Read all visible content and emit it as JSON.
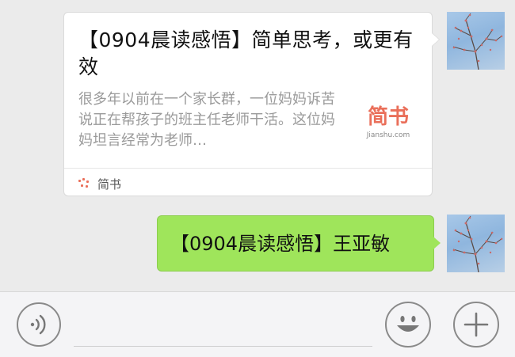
{
  "conversation": {
    "messages": [
      {
        "type": "link_card",
        "title": "【0904晨读感悟】简单思考，或更有效",
        "description": "很多年以前在一个家长群，一位妈妈诉苦说正在帮孩子的班主任老师干活。这位妈妈坦言经常为老师…",
        "thumbnail_text": "简书",
        "thumbnail_subtext": "Jianshu.com",
        "source": "简书"
      },
      {
        "type": "text",
        "text": "【0904晨读感悟】王亚敏",
        "bubble_color": "#9fe55b"
      }
    ]
  },
  "input_bar": {
    "voice_icon": "voice-icon",
    "emoji_icon": "emoji-icon",
    "plus_icon": "plus-icon"
  },
  "colors": {
    "background": "#ebebeb",
    "jianshu_brand": "#ea6f5a",
    "sent_bubble": "#9fe55b"
  }
}
